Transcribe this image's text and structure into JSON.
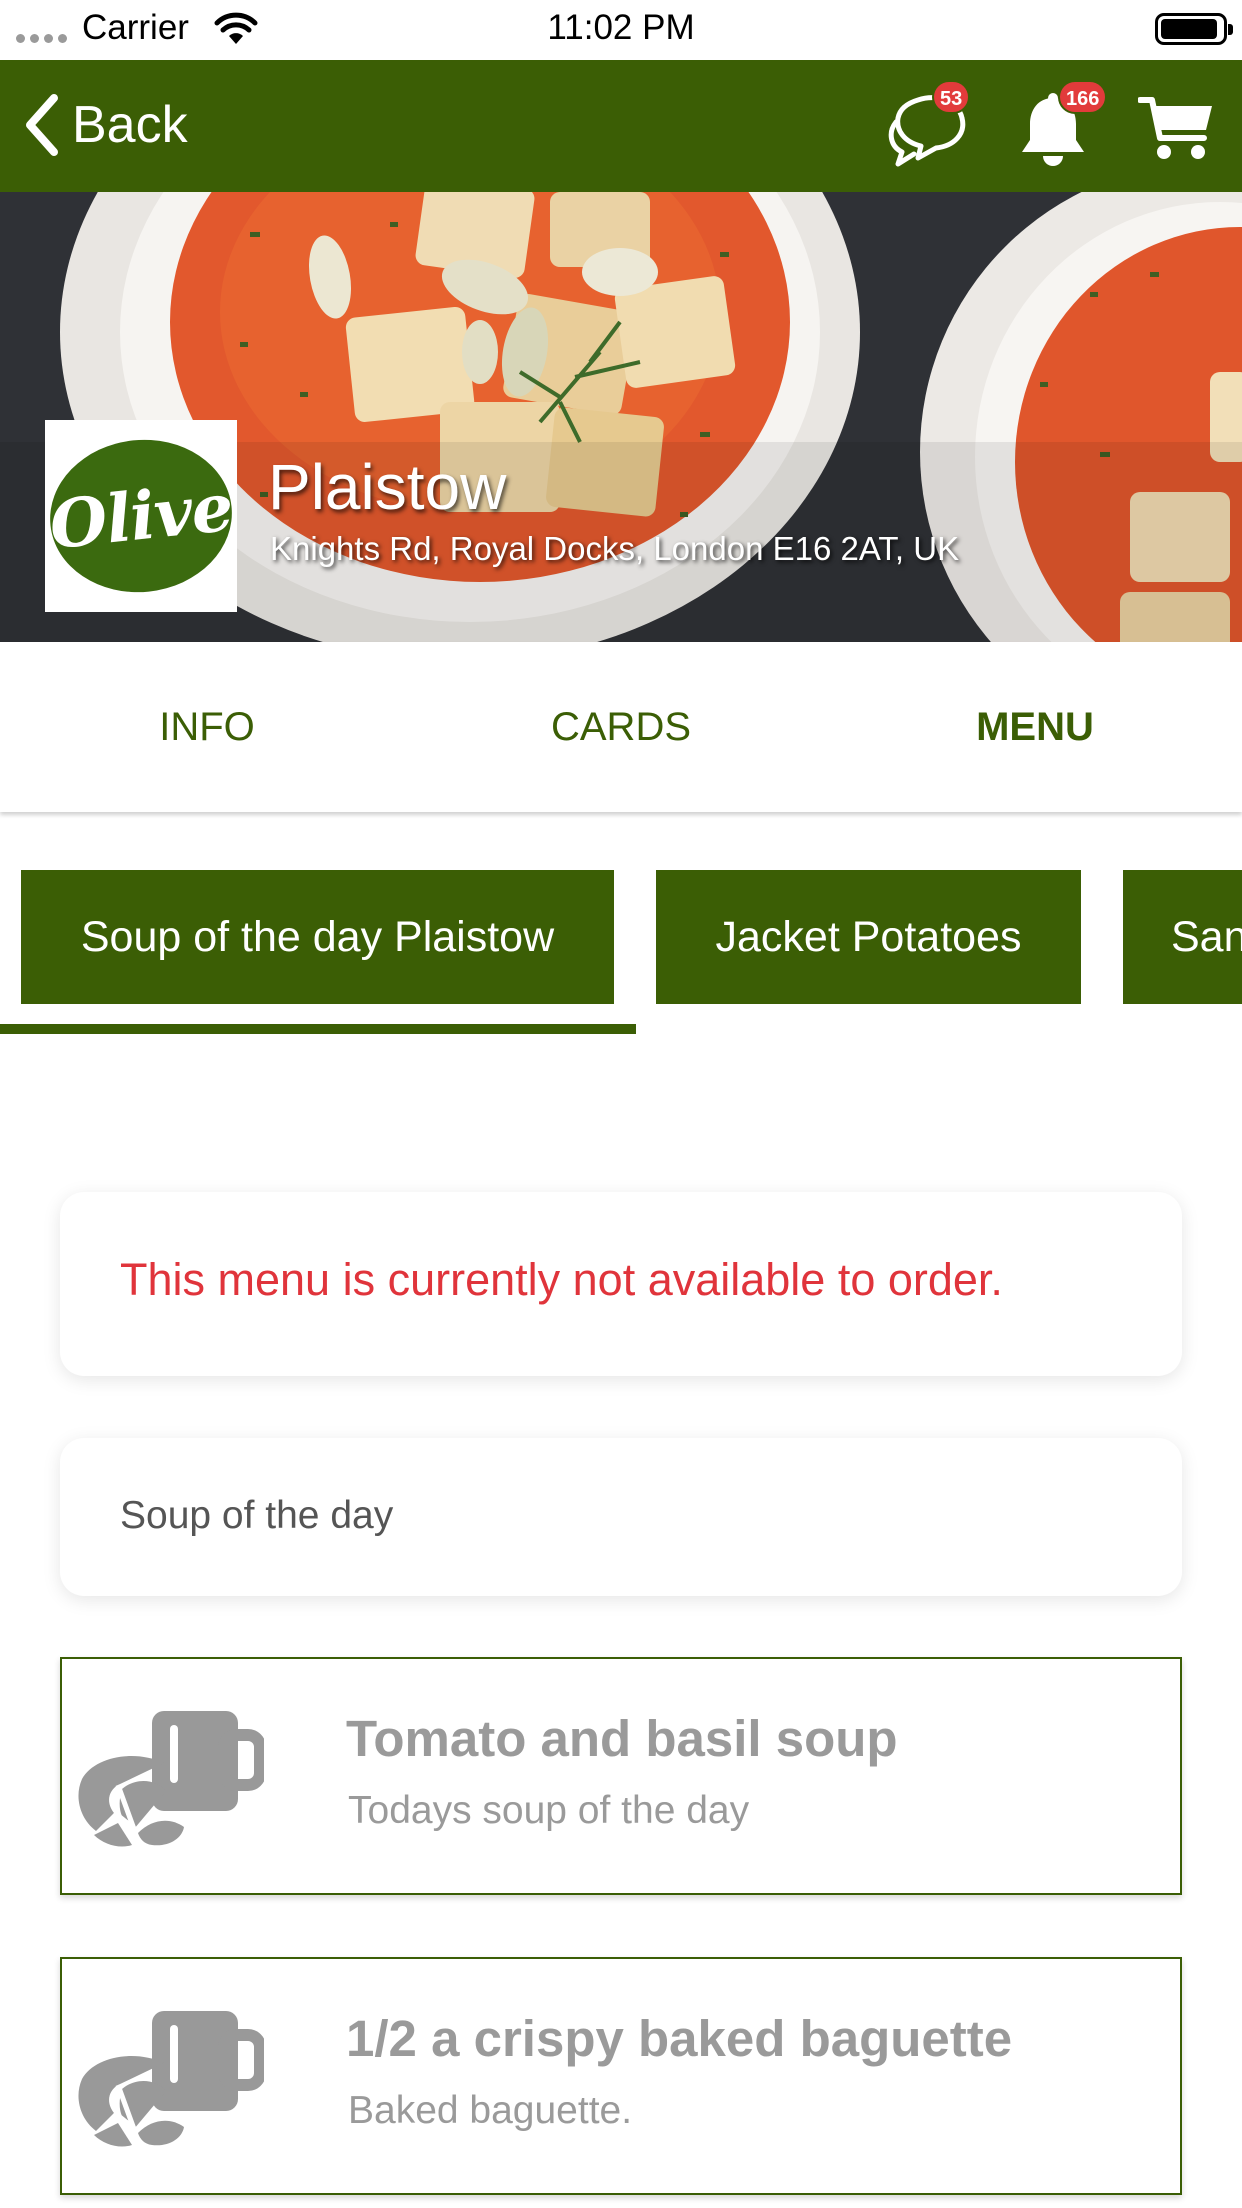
{
  "status_bar": {
    "carrier": "Carrier",
    "time": "11:02 PM",
    "icons": [
      "signal-dots-icon",
      "wifi-icon",
      "battery-icon"
    ]
  },
  "nav": {
    "back_label": "Back",
    "chat_badge": "53",
    "notifications_badge": "166",
    "icons": [
      "back-chevron-icon",
      "chat-bubbles-icon",
      "bell-icon",
      "cart-icon"
    ]
  },
  "venue": {
    "logo_text": "Olive",
    "name": "Plaistow",
    "address": "Knights Rd, Royal Docks, London E16 2AT, UK"
  },
  "tabs": [
    {
      "label": "INFO",
      "active": false
    },
    {
      "label": "CARDS",
      "active": false
    },
    {
      "label": "MENU",
      "active": true
    }
  ],
  "categories": [
    {
      "label": "Soup of the day Plaistow",
      "selected": true
    },
    {
      "label": "Jacket Potatoes",
      "selected": false
    },
    {
      "label": "San",
      "selected": false
    }
  ],
  "menu": {
    "notice": "This menu is currently not available to order.",
    "section_title": "Soup of the day",
    "items": [
      {
        "title": "Tomato and basil soup",
        "description": "Todays soup of the day",
        "icon": "croissant-coffee-icon"
      },
      {
        "title": "1/2 a crispy baked baguette",
        "description": "Baked baguette.",
        "icon": "croissant-coffee-icon"
      }
    ]
  },
  "colors": {
    "brand_green": "#3b5e05",
    "badge_red": "#e23b3b",
    "notice_red": "#e0343b",
    "muted_gray": "#9a9a9a"
  }
}
